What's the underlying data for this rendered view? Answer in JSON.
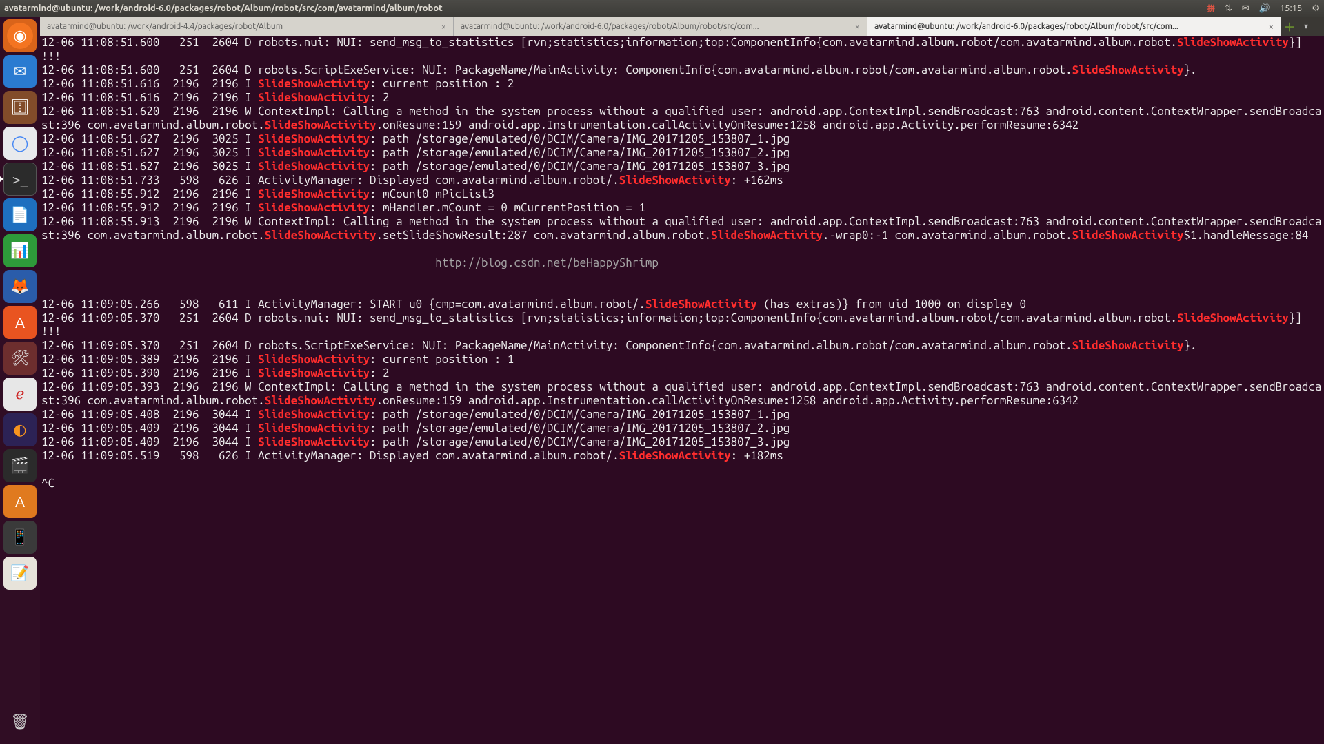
{
  "top_panel": {
    "title": "avatarmind@ubuntu: /work/android-6.0/packages/robot/Album/robot/src/com/avatarmind/album/robot",
    "ime": "拼",
    "clock": "15:15"
  },
  "tabs": {
    "t1": "avatarmind@ubuntu: /work/android-4.4/packages/robot/Album",
    "t2": "avatarmind@ubuntu: /work/android-6.0/packages/robot/Album/robot/src/com...",
    "t3": "avatarmind@ubuntu: /work/android-6.0/packages/robot/Album/robot/src/com..."
  },
  "watermark": "http://blog.csdn.net/beHappyShrimp",
  "prompt_end": "^C",
  "hl": "SlideShowActivity",
  "log": [
    {
      "pre": "12-06 11:08:51.600   251  2604 D robots.nui: NUI: send_msg_to_statistics [rvn;statistics;information;top:ComponentInfo{com.avatarmind.album.robot/com.avatarmind.album.robot.",
      "hl": true,
      "post": "}] !!!"
    },
    {
      "pre": "12-06 11:08:51.600   251  2604 D robots.ScriptExeService: NUI: PackageName/MainActivity: ComponentInfo{com.avatarmind.album.robot/com.avatarmind.album.robot.",
      "hl": true,
      "post": "}."
    },
    {
      "pre": "12-06 11:08:51.616  2196  2196 I ",
      "hl": true,
      "post": ": current position : 2"
    },
    {
      "pre": "12-06 11:08:51.616  2196  2196 I ",
      "hl": true,
      "post": ": 2"
    },
    {
      "raw": "w1"
    },
    {
      "pre": "12-06 11:08:51.627  2196  3025 I ",
      "hl": true,
      "post": ": path /storage/emulated/0/DCIM/Camera/IMG_20171205_153807_1.jpg"
    },
    {
      "pre": "12-06 11:08:51.627  2196  3025 I ",
      "hl": true,
      "post": ": path /storage/emulated/0/DCIM/Camera/IMG_20171205_153807_2.jpg"
    },
    {
      "pre": "12-06 11:08:51.627  2196  3025 I ",
      "hl": true,
      "post": ": path /storage/emulated/0/DCIM/Camera/IMG_20171205_153807_3.jpg"
    },
    {
      "raw": "am1"
    },
    {
      "pre": "12-06 11:08:55.912  2196  2196 I ",
      "hl": true,
      "post": ": mCount0 mPicList3"
    },
    {
      "pre": "12-06 11:08:55.912  2196  2196 I ",
      "hl": true,
      "post": ": mHandler.mCount = 0 mCurrentPosition = 1"
    },
    {
      "raw": "w2"
    },
    {
      "raw": "blank"
    },
    {
      "raw": "watermark"
    },
    {
      "raw": "blank"
    },
    {
      "raw": "blank"
    },
    {
      "raw": "start"
    },
    {
      "pre": "12-06 11:09:05.370   251  2604 D robots.nui: NUI: send_msg_to_statistics [rvn;statistics;information;top:ComponentInfo{com.avatarmind.album.robot/com.avatarmind.album.robot.",
      "hl": true,
      "post": "}] !!!"
    },
    {
      "pre": "12-06 11:09:05.370   251  2604 D robots.ScriptExeService: NUI: PackageName/MainActivity: ComponentInfo{com.avatarmind.album.robot/com.avatarmind.album.robot.",
      "hl": true,
      "post": "}."
    },
    {
      "pre": "12-06 11:09:05.389  2196  2196 I ",
      "hl": true,
      "post": ": current position : 1"
    },
    {
      "pre": "12-06 11:09:05.390  2196  2196 I ",
      "hl": true,
      "post": ": 2"
    },
    {
      "raw": "w3"
    },
    {
      "pre": "12-06 11:09:05.408  2196  3044 I ",
      "hl": true,
      "post": ": path /storage/emulated/0/DCIM/Camera/IMG_20171205_153807_1.jpg"
    },
    {
      "pre": "12-06 11:09:05.409  2196  3044 I ",
      "hl": true,
      "post": ": path /storage/emulated/0/DCIM/Camera/IMG_20171205_153807_2.jpg"
    },
    {
      "pre": "12-06 11:09:05.409  2196  3044 I ",
      "hl": true,
      "post": ": path /storage/emulated/0/DCIM/Camera/IMG_20171205_153807_3.jpg"
    },
    {
      "raw": "am2"
    }
  ],
  "special": {
    "w1_a": "12-06 11:08:51.620  2196  2196 W ContextImpl: Calling a method in the system process without a qualified user: android.app.ContextImpl.sendBroadcast:763 android.content.ContextWrapper.sendBroadcast:396 com.avatarmind.album.robot.",
    "w1_b": ".onResume:159 android.app.Instrumentation.callActivityOnResume:1258 android.app.Activity.performResume:6342",
    "am1_a": "12-06 11:08:51.733   598   626 I ActivityManager: Displayed com.avatarmind.album.robot/.",
    "am1_b": ": +162ms",
    "w2_a": "12-06 11:08:55.913  2196  2196 W ContextImpl: Calling a method in the system process without a qualified user: android.app.ContextImpl.sendBroadcast:763 android.content.ContextWrapper.sendBroadcast:396 com.avatarmind.album.robot.",
    "w2_b": ".setSlideShowResult:287 com.avatarmind.album.robot.",
    "w2_c": ".-wrap0:-1 com.avatarmind.album.robot.",
    "w2_d": "$1.handleMessage:84",
    "start_a": "12-06 11:09:05.266   598   611 I ActivityManager: START u0 {cmp=com.avatarmind.album.robot/.",
    "start_b": " (has extras)} from uid 1000 on display 0",
    "w3_a": "12-06 11:09:05.393  2196  2196 W ContextImpl: Calling a method in the system process without a qualified user: android.app.ContextImpl.sendBroadcast:763 android.content.ContextWrapper.sendBroadcast:396 com.avatarmind.album.robot.",
    "w3_b": ".onResume:159 android.app.Instrumentation.callActivityOnResume:1258 android.app.Activity.performResume:6342",
    "am2_a": "12-06 11:09:05.519   598   626 I ActivityManager: Displayed com.avatarmind.album.robot/.",
    "am2_b": ": +182ms"
  }
}
